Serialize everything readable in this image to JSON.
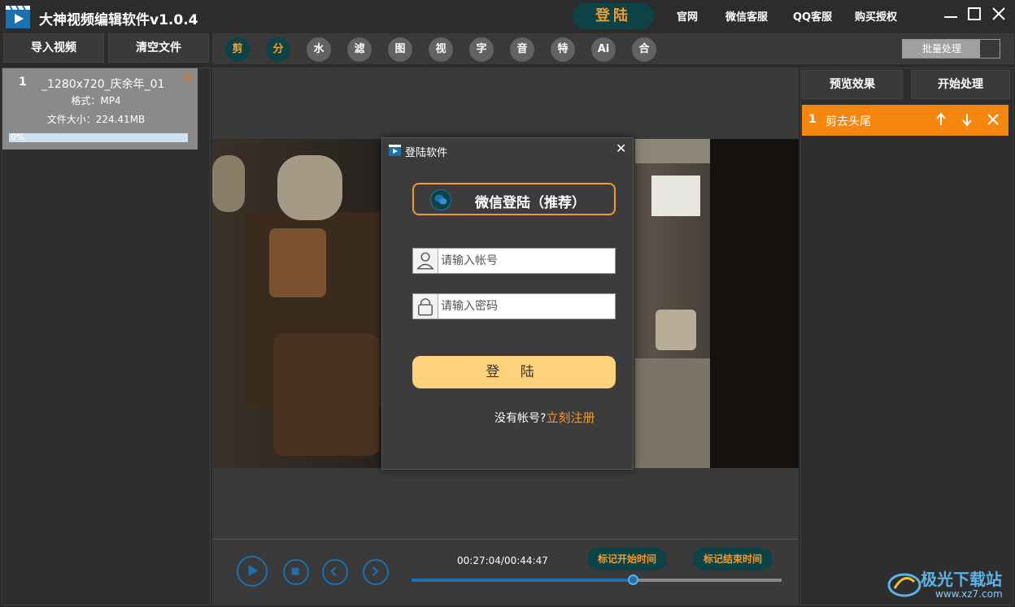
{
  "app": {
    "title": "大神视频编辑软件v1.0.4",
    "login": "登陆",
    "links": [
      "官网",
      "微信客服",
      "QQ客服",
      "购买授权"
    ]
  },
  "toolbar": {
    "import_label": "导入视频",
    "clear_label": "清空文件",
    "tools": [
      "剪",
      "分",
      "水",
      "滤",
      "图",
      "视",
      "字",
      "音",
      "特",
      "Ai",
      "合"
    ],
    "batch_label": "批量处理"
  },
  "file": {
    "index": "1",
    "name": "_1280x720_庆余年_01",
    "format": "格式：MP4",
    "size": "文件大小：224.41MB",
    "progress_label": "0%",
    "progress": 0
  },
  "right": {
    "preview_label": "预览效果",
    "start_label": "开始处理",
    "ops": [
      {
        "index": "1",
        "label": "剪去头尾"
      }
    ]
  },
  "player": {
    "time": "00:27:04/00:44:47",
    "mark_start": "标记开始时间",
    "mark_end": "标记结束时间",
    "progress": 0.6
  },
  "dialog": {
    "title": "登陆软件",
    "wechat_label": "微信登陆（推荐）",
    "account_placeholder": "请输入帐号",
    "password_placeholder": "请输入密码",
    "login_label": "登 陆",
    "no_account": "没有帐号?",
    "register": "立刻注册"
  },
  "watermark": {
    "text": "极光下载站",
    "sub": "www.xz7.com"
  },
  "colors": {
    "accent_orange": "#f39a2c",
    "accent_teal": "#0d4347",
    "accent_blue": "#1e6fae",
    "login_button": "#fed27c"
  }
}
